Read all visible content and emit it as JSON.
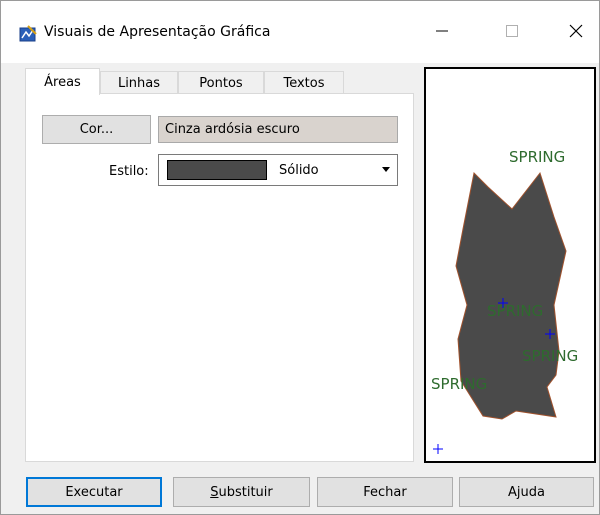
{
  "window": {
    "title": "Visuais de Apresentação Gráfica",
    "controls": {
      "minimize": "–",
      "maximize": "☐",
      "close": "✕"
    }
  },
  "tabs": [
    {
      "label": "Áreas",
      "active": true
    },
    {
      "label": "Linhas",
      "active": false
    },
    {
      "label": "Pontos",
      "active": false
    },
    {
      "label": "Textos",
      "active": false
    }
  ],
  "areas": {
    "cor_button": "Cor...",
    "cor_value": "Cinza ardósia escuro",
    "estilo_label": "Estilo:",
    "estilo_value": "Sólido",
    "fill_color": "#4a4a4a",
    "border_color": "#a0522d"
  },
  "preview": {
    "labels": [
      "SPRING",
      "SPRING",
      "SPRING",
      "SPRING"
    ],
    "label_color": "#2e6b2e",
    "point_color": "#0000ff"
  },
  "buttons": {
    "executar": "Executar",
    "substituir_first": "S",
    "substituir_rest": "ubstituir",
    "fechar": "Fechar",
    "ajuda": "Ajuda"
  }
}
